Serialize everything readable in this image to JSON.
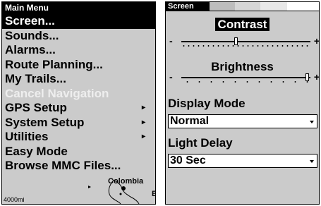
{
  "main_menu": {
    "title": "Main Menu",
    "items": [
      {
        "label": "Screen...",
        "selected": true,
        "disabled": false,
        "submenu": false
      },
      {
        "label": "Sounds...",
        "selected": false,
        "disabled": false,
        "submenu": false
      },
      {
        "label": "Alarms...",
        "selected": false,
        "disabled": false,
        "submenu": false
      },
      {
        "label": "Route Planning...",
        "selected": false,
        "disabled": false,
        "submenu": false
      },
      {
        "label": "My Trails...",
        "selected": false,
        "disabled": false,
        "submenu": false
      },
      {
        "label": "Cancel Navigation",
        "selected": false,
        "disabled": true,
        "submenu": false
      },
      {
        "label": "GPS Setup",
        "selected": false,
        "disabled": false,
        "submenu": true
      },
      {
        "label": "System Setup",
        "selected": false,
        "disabled": false,
        "submenu": true
      },
      {
        "label": "Utilities",
        "selected": false,
        "disabled": false,
        "submenu": true
      },
      {
        "label": "Easy Mode",
        "selected": false,
        "disabled": false,
        "submenu": false
      },
      {
        "label": "Browse MMC Files...",
        "selected": false,
        "disabled": false,
        "submenu": false
      }
    ],
    "map": {
      "place_label": "Colombia",
      "scale_label": "4000mi",
      "edge_letter": "E"
    }
  },
  "screen_menu": {
    "title": "Screen",
    "contrast": {
      "label": "Contrast",
      "minus": "-",
      "plus": "+",
      "level": 0.42
    },
    "brightness": {
      "label": "Brightness",
      "minus": "-",
      "plus": "+",
      "level": 0.97
    },
    "display_mode": {
      "label": "Display Mode",
      "value": "Normal"
    },
    "light_delay": {
      "label": "Light Delay",
      "value": "30 Sec"
    }
  }
}
